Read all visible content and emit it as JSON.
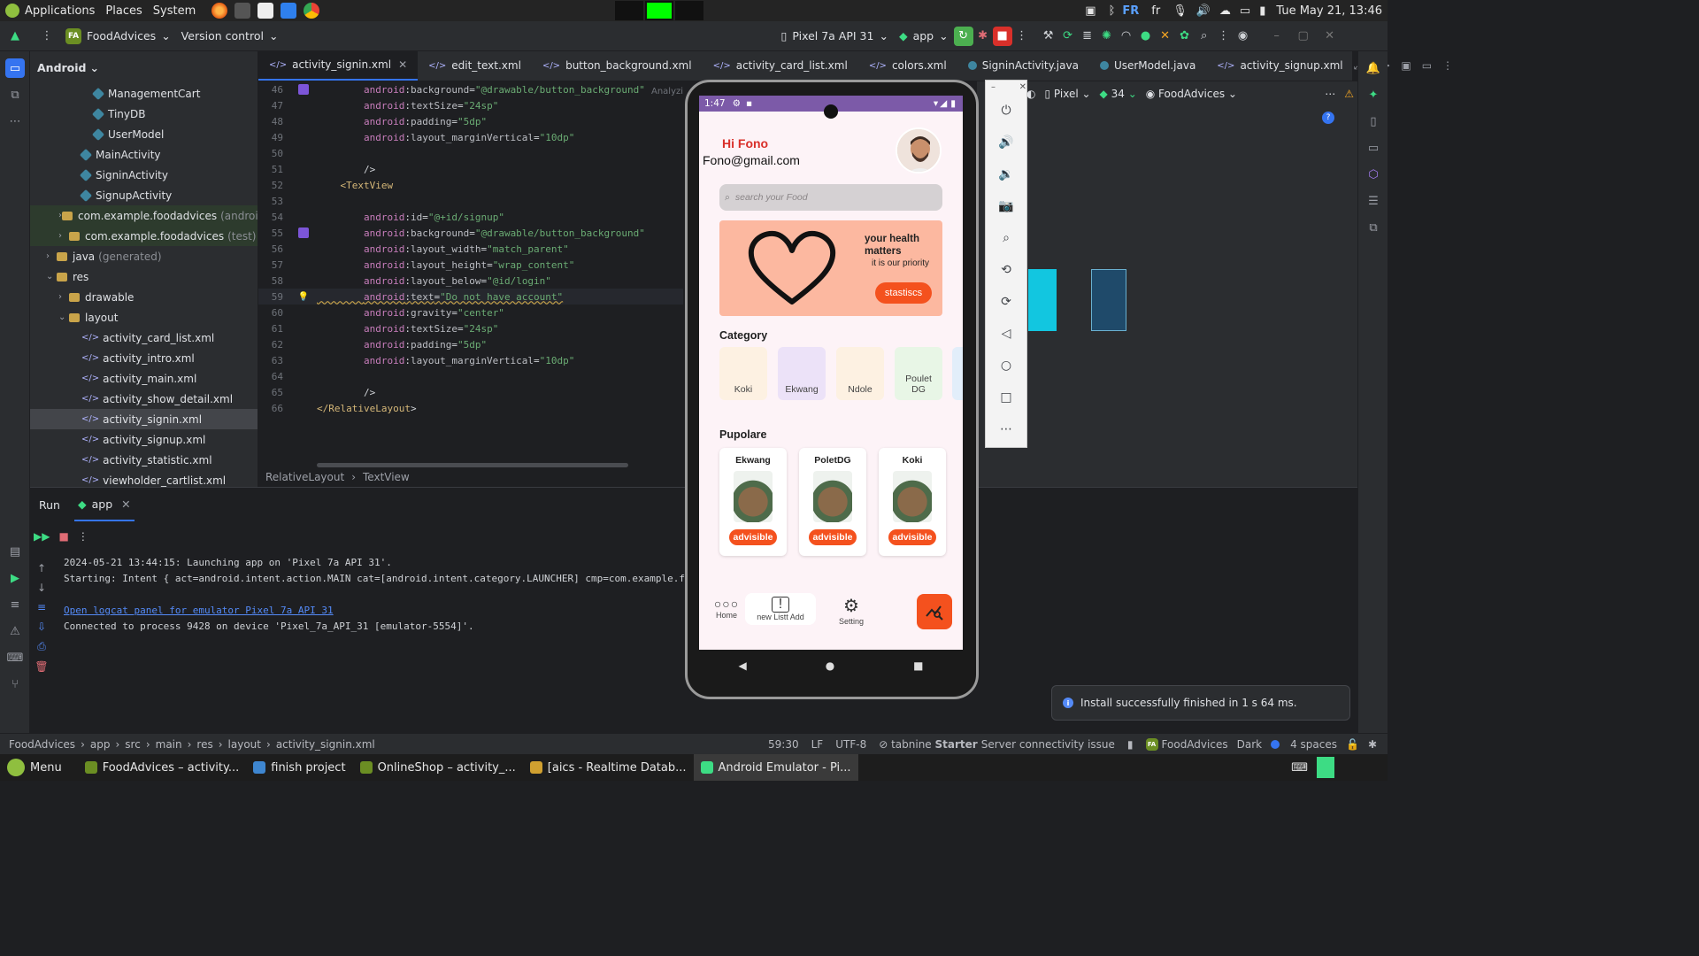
{
  "system_bar": {
    "applications": "Applications",
    "places": "Places",
    "system": "System",
    "keyboard_layout": "FR",
    "keyboard_layout_small": "fr",
    "datetime": "Tue May 21, 13:46"
  },
  "ide": {
    "project_badge": "FA",
    "project_name": "FoodAdvices",
    "version_control": "Version control",
    "device": "Pixel 7a API 31",
    "run_config": "app"
  },
  "project_panel": {
    "view": "Android",
    "items": [
      {
        "label": "ManagementCart",
        "kind": "class",
        "indent": 5
      },
      {
        "label": "TinyDB",
        "kind": "class",
        "indent": 5
      },
      {
        "label": "UserModel",
        "kind": "class",
        "indent": 5
      },
      {
        "label": "MainActivity",
        "kind": "class",
        "indent": 4
      },
      {
        "label": "SigninActivity",
        "kind": "class",
        "indent": 4
      },
      {
        "label": "SignupActivity",
        "kind": "class",
        "indent": 4
      },
      {
        "label": "com.example.foodadvices",
        "suffix": "(androidTe",
        "kind": "folder",
        "indent": 3,
        "green": true
      },
      {
        "label": "com.example.foodadvices",
        "suffix": "(test)",
        "kind": "folder",
        "indent": 3,
        "green": true
      },
      {
        "label": "java",
        "suffix": "(generated)",
        "kind": "folder",
        "indent": 2
      },
      {
        "label": "res",
        "kind": "folder",
        "indent": 2,
        "open": true
      },
      {
        "label": "drawable",
        "kind": "folder",
        "indent": 3
      },
      {
        "label": "layout",
        "kind": "folder",
        "indent": 3,
        "open": true
      },
      {
        "label": "activity_card_list.xml",
        "kind": "xml",
        "indent": 4
      },
      {
        "label": "activity_intro.xml",
        "kind": "xml",
        "indent": 4
      },
      {
        "label": "activity_main.xml",
        "kind": "xml",
        "indent": 4
      },
      {
        "label": "activity_show_detail.xml",
        "kind": "xml",
        "indent": 4
      },
      {
        "label": "activity_signin.xml",
        "kind": "xml",
        "indent": 4,
        "selected": true
      },
      {
        "label": "activity_signup.xml",
        "kind": "xml",
        "indent": 4
      },
      {
        "label": "activity_statistic.xml",
        "kind": "xml",
        "indent": 4
      },
      {
        "label": "viewholder_cartlist.xml",
        "kind": "xml",
        "indent": 4
      }
    ]
  },
  "tabs": [
    {
      "label": "activity_signin.xml",
      "kind": "xml",
      "active": true
    },
    {
      "label": "edit_text.xml",
      "kind": "xml"
    },
    {
      "label": "button_background.xml",
      "kind": "xml"
    },
    {
      "label": "activity_card_list.xml",
      "kind": "xml"
    },
    {
      "label": "colors.xml",
      "kind": "xml"
    },
    {
      "label": "SigninActivity.java",
      "kind": "java"
    },
    {
      "label": "UserModel.java",
      "kind": "java"
    },
    {
      "label": "activity_signup.xml",
      "kind": "xml"
    }
  ],
  "editor": {
    "lines": [
      {
        "n": "46",
        "text": "        android:background=\"@drawable/button_background\"",
        "mark": true
      },
      {
        "n": "47",
        "text": "        android:textSize=\"24sp\""
      },
      {
        "n": "48",
        "text": "        android:padding=\"5dp\""
      },
      {
        "n": "49",
        "text": "        android:layout_marginVertical=\"10dp\""
      },
      {
        "n": "50",
        "text": ""
      },
      {
        "n": "51",
        "text": "        />"
      },
      {
        "n": "52",
        "text": "    <TextView"
      },
      {
        "n": "53",
        "text": ""
      },
      {
        "n": "54",
        "text": "        android:id=\"@+id/signup\""
      },
      {
        "n": "55",
        "text": "        android:background=\"@drawable/button_background\"",
        "mark": true
      },
      {
        "n": "56",
        "text": "        android:layout_width=\"match_parent\""
      },
      {
        "n": "57",
        "text": "        android:layout_height=\"wrap_content\""
      },
      {
        "n": "58",
        "text": "        android:layout_below=\"@id/login\""
      },
      {
        "n": "59",
        "text": "        android:text=\"Do not have account\"",
        "bulb": true
      },
      {
        "n": "60",
        "text": "        android:gravity=\"center\""
      },
      {
        "n": "61",
        "text": "        android:textSize=\"24sp\""
      },
      {
        "n": "62",
        "text": "        android:padding=\"5dp\""
      },
      {
        "n": "63",
        "text": "        android:layout_marginVertical=\"10dp\""
      },
      {
        "n": "64",
        "text": ""
      },
      {
        "n": "65",
        "text": "        />"
      },
      {
        "n": "66",
        "text": "</RelativeLayout>"
      }
    ],
    "analyzing": "Analyzing",
    "breadcrumb": [
      "RelativeLayout",
      "TextView"
    ]
  },
  "run_panel": {
    "title": "Run",
    "tab": "app",
    "logs": [
      "2024-05-21 13:44:15: Launching app on 'Pixel 7a API 31'.",
      "Starting: Intent { act=android.intent.action.MAIN cat=[android.intent.category.LAUNCHER] cmp=com.example.fo",
      "",
      "Open logcat panel for emulator Pixel 7a API 31",
      "Connected to process 9428 on device 'Pixel_7a_API_31 [emulator-5554]'."
    ]
  },
  "emulator_header": {
    "device": "Pixel",
    "api": "34",
    "project": "FoodAdvices"
  },
  "phone": {
    "status_time": "1:47",
    "greeting": "Hi Fono",
    "email": "Fono@gmail.com",
    "search_placeholder": "search your Food",
    "health_title": "your health matters",
    "health_sub": "it is our priority",
    "health_button": "stastiscs",
    "category_title": "Category",
    "categories": [
      {
        "label": "Koki",
        "color": "#fdf1e2"
      },
      {
        "label": "Ekwang",
        "color": "#ece2f8"
      },
      {
        "label": "Ndole",
        "color": "#fdf1e2"
      },
      {
        "label": "Poulet DG",
        "color": "#e8f6e6"
      }
    ],
    "popular_title": "Pupolare",
    "popular": [
      {
        "name": "Ekwang",
        "button": "advisible"
      },
      {
        "name": "PoletDG",
        "button": "advisible"
      },
      {
        "name": "Koki",
        "button": "advisible"
      }
    ],
    "nav": {
      "home": "Home",
      "new_list": "new Listt Add",
      "setting": "Setting"
    }
  },
  "toast": "Install successfully finished in 1 s 64 ms.",
  "status_bar": {
    "path": [
      "FoodAdvices",
      "app",
      "src",
      "main",
      "res",
      "layout",
      "activity_signin.xml"
    ],
    "position": "59:30",
    "line_sep": "LF",
    "encoding": "UTF-8",
    "tabnine": "tabnine",
    "starter": "Starter",
    "server_issue": "Server connectivity issue",
    "project": "FoodAdvices",
    "theme": "Dark",
    "indent": "4 spaces"
  },
  "taskbar": {
    "menu": "Menu",
    "items": [
      {
        "label": "FoodAdvices – activity...",
        "color": "#6b8e23"
      },
      {
        "label": "finish project",
        "color": "#3e86d0"
      },
      {
        "label": "OnlineShop – activity_...",
        "color": "#6b8e23"
      },
      {
        "label": "[aics - Realtime Datab...",
        "color": "#d0a030"
      },
      {
        "label": "Android Emulator - Pi...",
        "color": "#3ddc84",
        "active": true
      }
    ]
  }
}
